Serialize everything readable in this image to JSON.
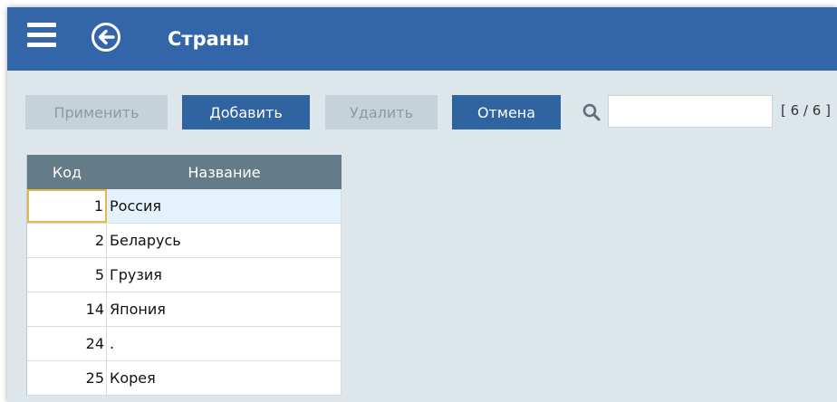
{
  "header": {
    "title": "Страны",
    "menu_icon": "hamburger-menu-icon",
    "back_icon": "back-arrow-circle-icon",
    "bg_color": "#3266a8"
  },
  "toolbar": {
    "apply_label": "Применить",
    "add_label": "Добавить",
    "delete_label": "Удалить",
    "cancel_label": "Отмена",
    "search_placeholder": "",
    "search_value": "",
    "counter": "[ 6 / 6 ]"
  },
  "table": {
    "columns": [
      "Код",
      "Название"
    ],
    "rows": [
      {
        "code": "1",
        "name": "Россия"
      },
      {
        "code": "2",
        "name": "Беларусь"
      },
      {
        "code": "5",
        "name": "Грузия"
      },
      {
        "code": "14",
        "name": "Япония"
      },
      {
        "code": "24",
        "name": "."
      },
      {
        "code": "25",
        "name": "Корея"
      }
    ]
  }
}
